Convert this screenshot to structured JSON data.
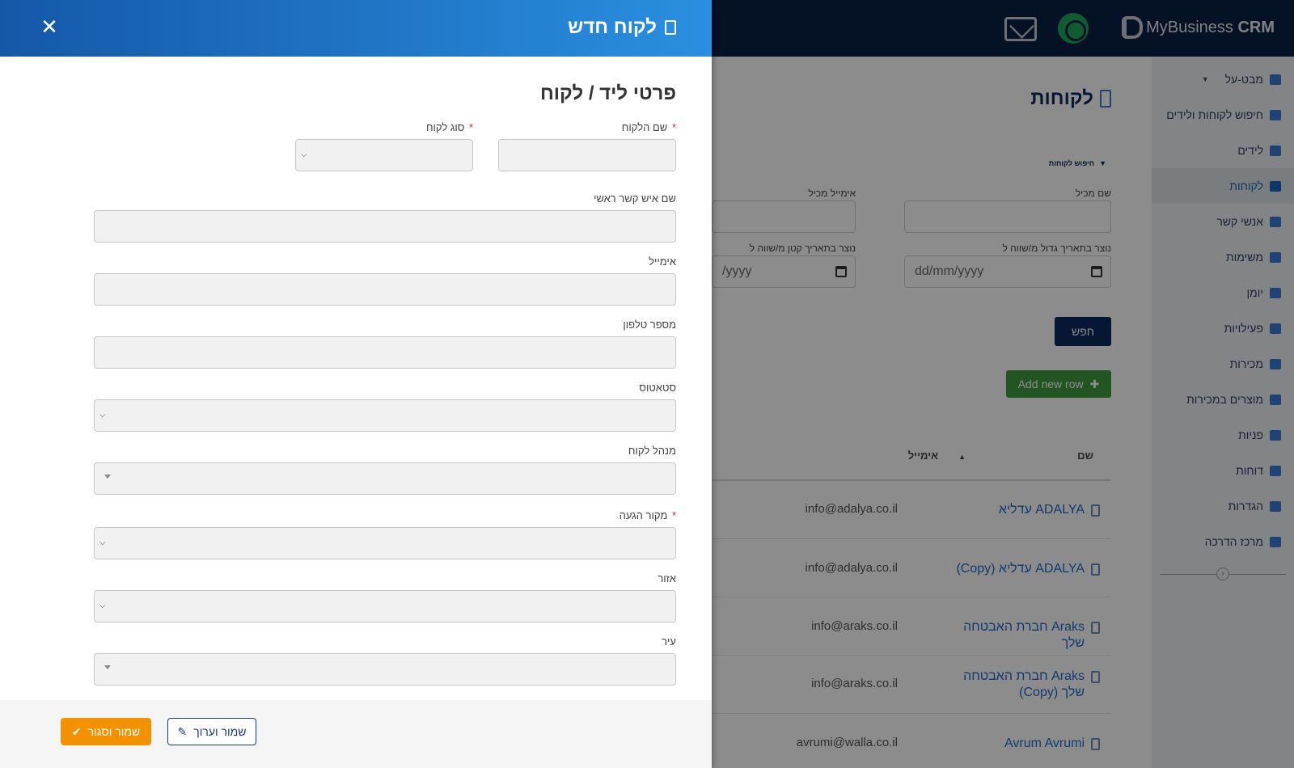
{
  "topbar": {
    "brand_name": "MyBusiness",
    "brand_suffix": "CRM",
    "icons": [
      "whatsapp-icon",
      "mail-icon"
    ]
  },
  "sidebar": {
    "items": [
      {
        "label": "מבט-על",
        "icon": "bar-chart-icon",
        "has_caret": true
      },
      {
        "label": "חיפוש לקוחות ולידים",
        "icon": "search-icon"
      },
      {
        "label": "לידים",
        "icon": "megaphone-icon"
      },
      {
        "label": "לקוחות",
        "icon": "building-icon",
        "active": true
      },
      {
        "label": "אנשי קשר",
        "icon": "user-icon"
      },
      {
        "label": "משימות",
        "icon": "list-icon"
      },
      {
        "label": "יומן",
        "icon": "calendar-icon"
      },
      {
        "label": "פעילויות",
        "icon": "calendar-check-icon"
      },
      {
        "label": "מכירות",
        "icon": "handshake-icon"
      },
      {
        "label": "מוצרים במכירות",
        "icon": "barcode-icon"
      },
      {
        "label": "פניות",
        "icon": "headset-icon"
      },
      {
        "label": "דוחות",
        "icon": "file-icon"
      },
      {
        "label": "הגדרות",
        "icon": "gear-icon"
      },
      {
        "label": "מרכז הדרכה",
        "icon": "question-icon"
      }
    ]
  },
  "content": {
    "title": "לקוחות",
    "filter_toggle": "חיפוש לקוחות",
    "filters": {
      "seller_name_label": "שם מכיל",
      "email_label": "אימייל מכיל",
      "created_after_label": "נוצר בתאריך גדול מ/שווה ל",
      "created_before_label": "נוצר בתאריך קטן מ/שווה ל",
      "created_after_placeholder": "dd/mm/yyyy",
      "created_before_placeholder": "/yyyy"
    },
    "search_button": "חפש",
    "add_button": "Add new row",
    "table": {
      "col_name": "שם",
      "col_email": "אימייל",
      "rows": [
        {
          "name": "ADALYA עדליא",
          "email": "info@adalya.co.il"
        },
        {
          "name": "ADALYA עדליא (Copy)",
          "email": "info@adalya.co.il"
        },
        {
          "name": "Araks חברת האבטחה שלך",
          "email": "info@araks.co.il"
        },
        {
          "name": "Araks חברת האבטחה שלך (Copy)",
          "email": "info@araks.co.il"
        },
        {
          "name": "Avrum Avrumi",
          "email": "avrumi@walla.co.il"
        }
      ]
    }
  },
  "panel": {
    "title": "לקוח חדש",
    "section_title": "פרטי ליד / לקוח",
    "fields": {
      "customer_name": {
        "label": "שם הלקוח",
        "required": true,
        "value": ""
      },
      "customer_type": {
        "label": "סוג לקוח",
        "required": true,
        "value": ""
      },
      "main_contact": {
        "label": "שם איש קשר ראשי",
        "value": ""
      },
      "email": {
        "label": "אימייל",
        "value": ""
      },
      "phone": {
        "label": "מספר טלפון",
        "value": ""
      },
      "status": {
        "label": "סטאטוס",
        "value": ""
      },
      "account_manager": {
        "label": "מנהל לקוח",
        "value": ""
      },
      "lead_source": {
        "label": "מקור הגעה",
        "required": true,
        "value": ""
      },
      "region": {
        "label": "אזור",
        "value": ""
      },
      "city": {
        "label": "עיר",
        "value": ""
      }
    },
    "required_mark": "*",
    "buttons": {
      "save_close": "שמור וסגור",
      "save_edit": "שמור וערוך"
    }
  },
  "colors": {
    "topbar": "#0a1f44",
    "header_gradient_start": "#1558a8",
    "header_gradient_end": "#2a8fe0",
    "save_close": "#f39200",
    "add_row": "#3f9b3f",
    "link": "#1e6bc6"
  }
}
